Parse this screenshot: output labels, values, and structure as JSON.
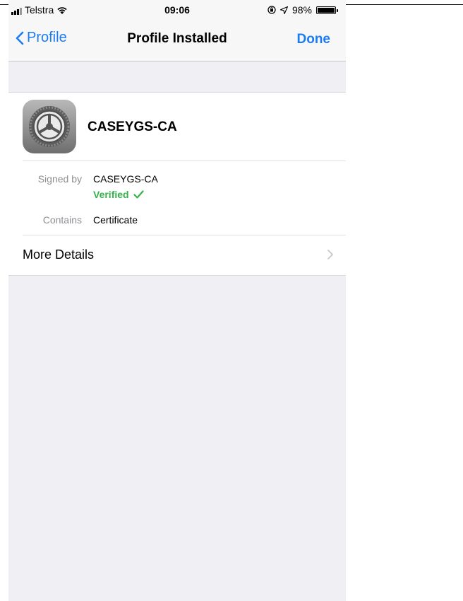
{
  "status_bar": {
    "carrier": "Telstra",
    "time": "09:06",
    "battery": "98%",
    "battery_level": 0.98
  },
  "nav": {
    "back_label": "Profile",
    "title": "Profile Installed",
    "done_label": "Done"
  },
  "profile": {
    "name": "CASEYGS-CA",
    "icon": "settings-gear-icon",
    "signed_by_key": "Signed by",
    "signed_by_value": "CASEYGS-CA",
    "verified_label": "Verified",
    "contains_key": "Contains",
    "contains_value": "Certificate"
  },
  "more_details": {
    "label": "More Details"
  },
  "colors": {
    "accent": "#1a7cf5",
    "verified": "#35b24b",
    "background": "#efeff4"
  }
}
